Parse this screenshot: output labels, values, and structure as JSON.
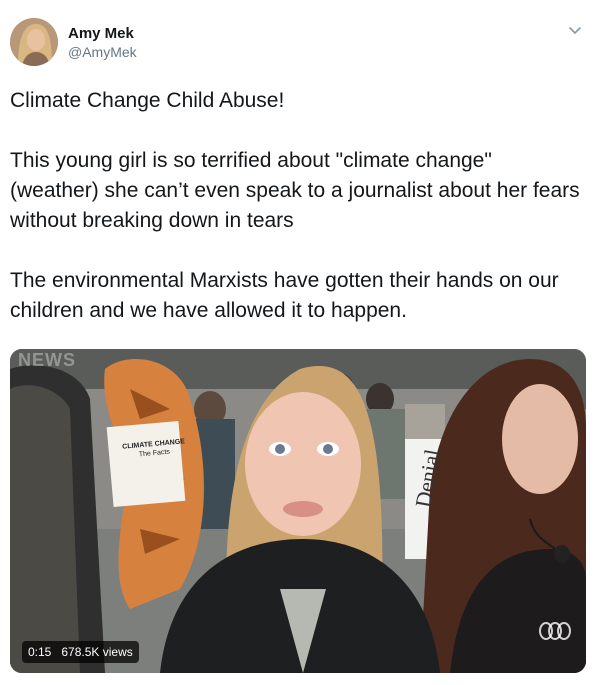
{
  "user": {
    "display_name": "Amy Mek",
    "handle": "@AmyMek"
  },
  "tweet": {
    "paragraphs": [
      "Climate Change Child Abuse!",
      "This young girl is so terrified about \"climate change\" (weather) she can’t even speak to a journalist about her fears without breaking down in tears",
      "The environmental Marxists have gotten their hands on our children and we have allowed it to happen."
    ]
  },
  "video": {
    "time": "0:15",
    "views": "678.5K views",
    "watermark": "NEWS",
    "book_title": "CLIMATE CHANGE",
    "book_subtitle": "The Facts",
    "sign_text": "Denial"
  },
  "colors": {
    "text_primary": "#14171a",
    "text_secondary": "#657786"
  },
  "icons": {
    "menu": "chevron-down-icon",
    "channel": "abc-logo-icon"
  }
}
